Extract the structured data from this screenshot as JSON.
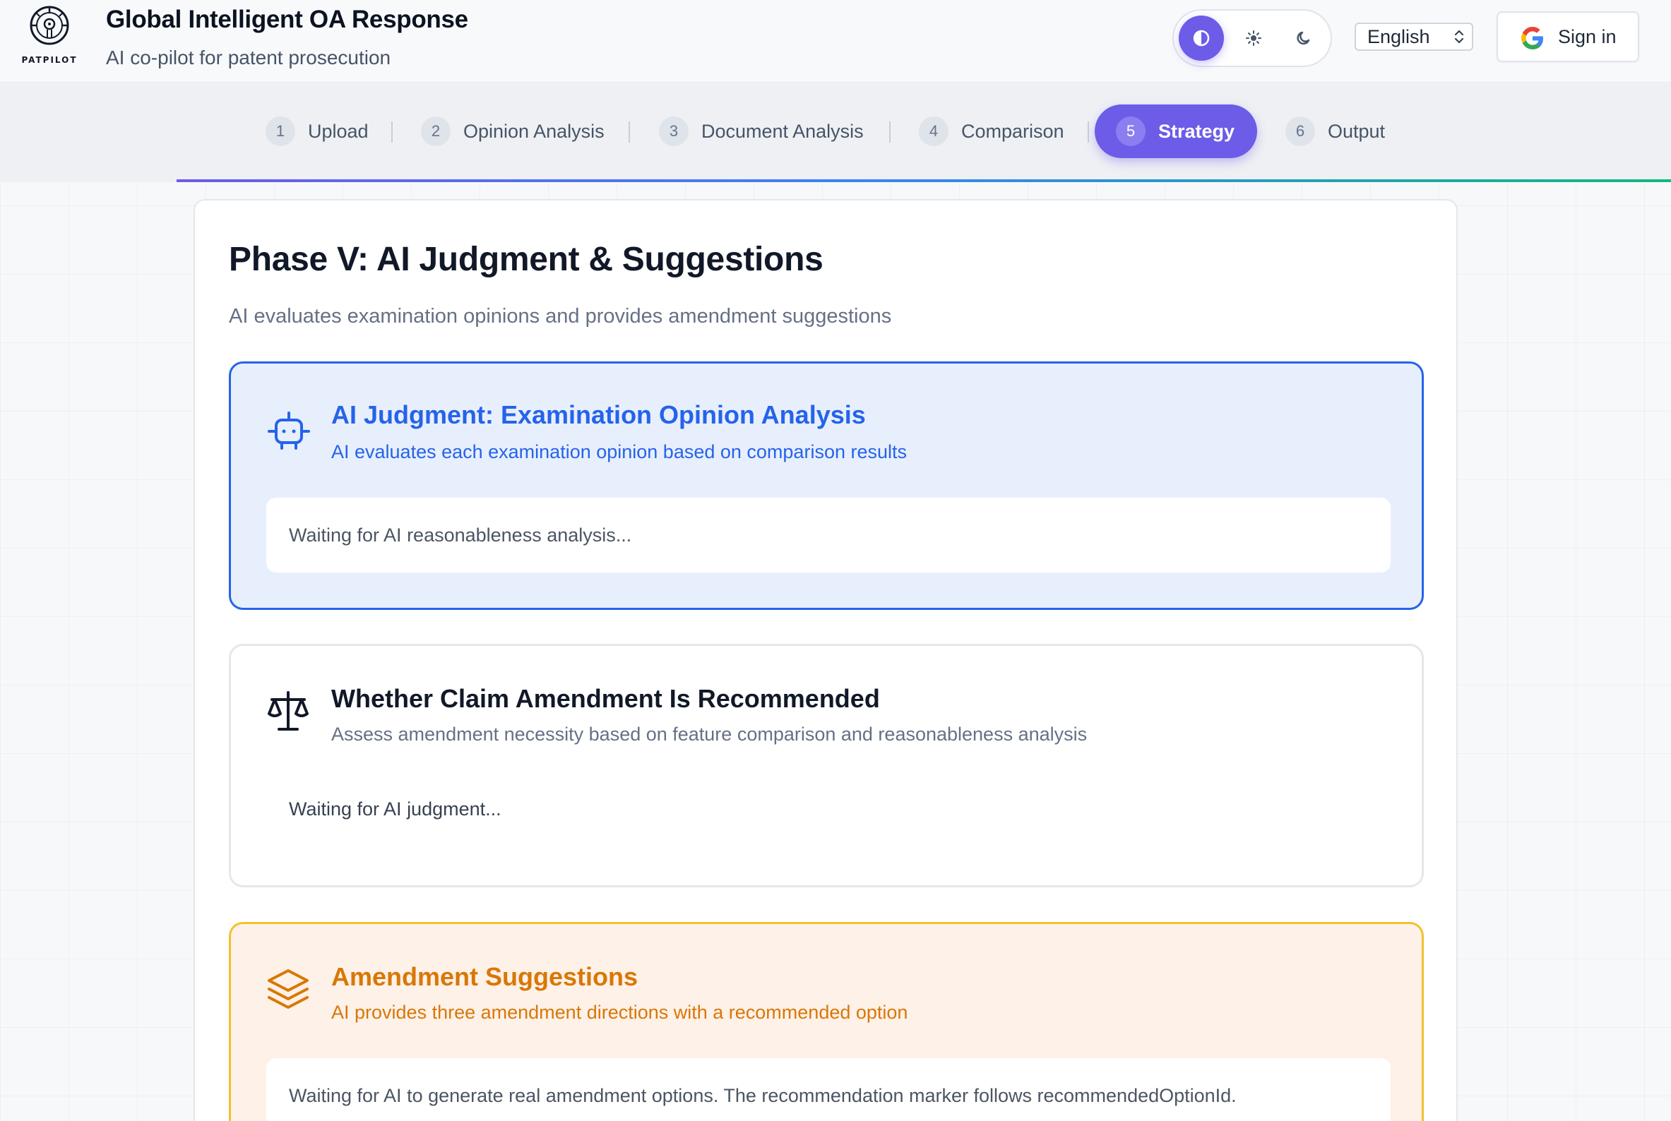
{
  "header": {
    "logo_text": "PATPILOT",
    "title": "Global Intelligent OA Response",
    "subtitle": "AI co-pilot for patent prosecution",
    "language": "English",
    "sign_in_label": "Sign in"
  },
  "theme": {
    "selected": "auto",
    "accent_color": "#6c5ce7"
  },
  "steps": [
    {
      "num": "1",
      "label": "Upload"
    },
    {
      "num": "2",
      "label": "Opinion Analysis"
    },
    {
      "num": "3",
      "label": "Document Analysis"
    },
    {
      "num": "4",
      "label": "Comparison"
    },
    {
      "num": "5",
      "label": "Strategy"
    },
    {
      "num": "6",
      "label": "Output"
    }
  ],
  "active_step": 5,
  "phase": {
    "title": "Phase V: AI Judgment & Suggestions",
    "description": "AI evaluates examination opinions and provides amendment suggestions"
  },
  "cards": {
    "ai_judgment": {
      "icon": "robot-icon",
      "title": "AI Judgment: Examination Opinion Analysis",
      "subtitle": "AI evaluates each examination opinion based on comparison results",
      "status": "Waiting for AI reasonableness analysis...",
      "color": "#2563eb"
    },
    "claim_amendment": {
      "icon": "scale-icon",
      "title": "Whether Claim Amendment Is Recommended",
      "subtitle": "Assess amendment necessity based on feature comparison and reasonableness analysis",
      "status": "Waiting for AI judgment..."
    },
    "amendment_suggestions": {
      "icon": "layers-icon",
      "title": "Amendment Suggestions",
      "subtitle": "AI provides three amendment directions with a recommended option",
      "status": "Waiting for AI to generate real amendment options. The recommendation marker follows recommendedOptionId.",
      "color": "#d97706"
    }
  }
}
